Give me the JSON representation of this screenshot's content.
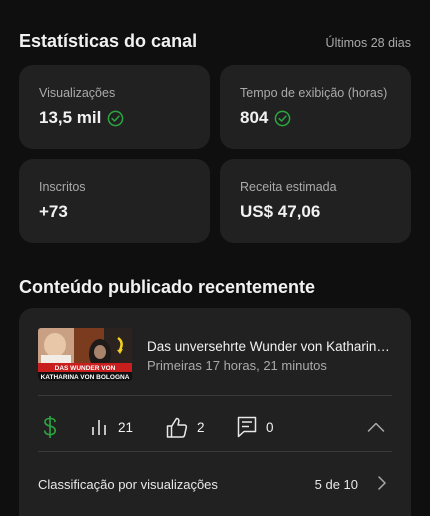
{
  "stats": {
    "title": "Estatísticas do canal",
    "period": "Últimos 28 dias",
    "cards": [
      {
        "label": "Visualizações",
        "value": "13,5 mil",
        "check": true
      },
      {
        "label": "Tempo de exibição (horas)",
        "value": "804",
        "check": true
      },
      {
        "label": "Inscritos",
        "value": "+73",
        "check": false
      },
      {
        "label": "Receita estimada",
        "value": "US$ 47,06",
        "check": false
      }
    ]
  },
  "recent": {
    "title": "Conteúdo publicado recentemente",
    "video": {
      "title": "Das unversehrte Wunder von Katharina von Bologna",
      "subtitle": "Primeiras 17 horas, 21 minutos",
      "thumb_caption": "KATHARINA VON BOLOGNA",
      "thumb_caption_top": "DAS WUNDER VON"
    },
    "metrics": {
      "views": "21",
      "likes": "2",
      "comments": "0"
    },
    "ranking": {
      "label": "Classificação por visualizações",
      "value": "5 de 10"
    }
  },
  "colors": {
    "accent_green": "#2ba640",
    "card_bg": "#212121",
    "page_bg": "#0f0f0f"
  }
}
